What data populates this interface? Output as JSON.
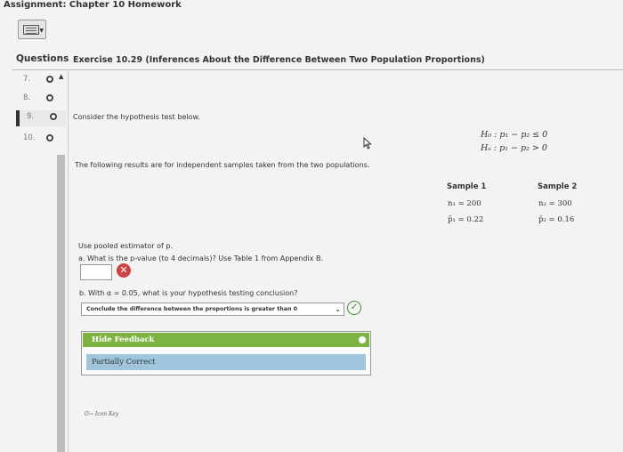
{
  "assignment": {
    "title": "Assignment: Chapter 10 Homework"
  },
  "toolbar": {
    "keyboard_icon": "keyboard-icon"
  },
  "sidebar": {
    "header": "Questions",
    "items": [
      {
        "number": "7.",
        "status": "circle"
      },
      {
        "number": "8.",
        "status": "circle"
      },
      {
        "number": "9.",
        "status": "circle"
      },
      {
        "number": "10.",
        "status": "circle"
      }
    ]
  },
  "exercise": {
    "title": "Exercise 10.29 (Inferences About the Difference Between Two Population Proportions)",
    "prompt": "Consider the hypothesis test below.",
    "hypotheses": {
      "h0": "H₀ : p₁ − p₂ ≤ 0",
      "ha": "Hₐ : p₁ − p₂ > 0"
    },
    "results_text": "The following results are for independent samples taken from the two populations.",
    "samples": [
      {
        "header": "Sample 1",
        "n": "n₁ = 200",
        "p": "p̄₁ = 0.22"
      },
      {
        "header": "Sample 2",
        "n": "n₂ = 300",
        "p": "p̄₂ = 0.16"
      }
    ],
    "instruction": "Use pooled estimator of p.",
    "part_a": "a. What is the p-value (to 4 decimals)? Use Table 1 from Appendix B.",
    "part_a_value": "",
    "part_b": "b. With α = 0.05, what is your hypothesis testing conclusion?",
    "part_b_selected": "Conclude the difference between the proportions is greater than 0"
  },
  "feedback": {
    "hide_label": "Hide Feedback",
    "status": "Partially Correct"
  },
  "icon_key": "Icon Key",
  "colors": {
    "green": "#7cb342",
    "blue": "#9fc6dc",
    "wrong": "#c44",
    "right": "#3a8a3a"
  }
}
